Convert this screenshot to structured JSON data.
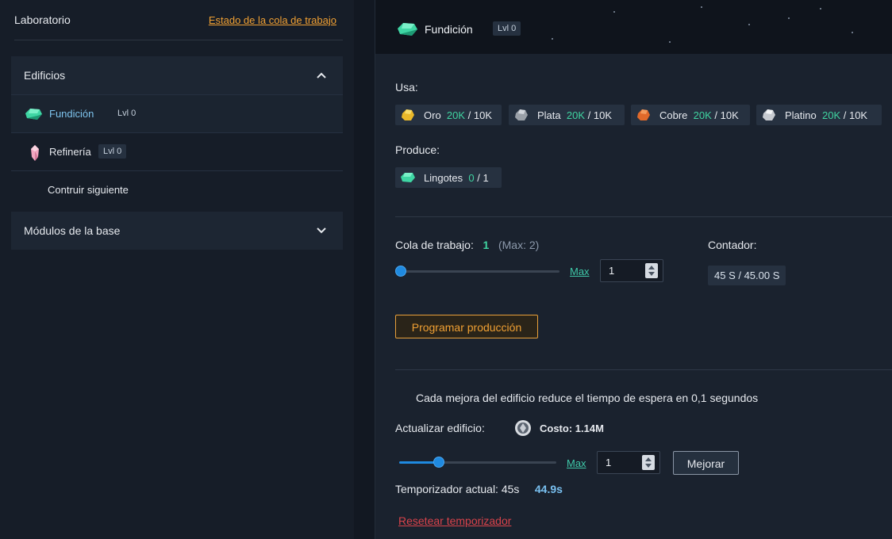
{
  "sidebar": {
    "title": "Laboratorio",
    "queue_link": "Estado de la cola de trabajo",
    "buildings": {
      "label": "Edificios",
      "items": [
        {
          "name": "Fundición",
          "level": "Lvl 0",
          "icon": "green-gem-icon"
        },
        {
          "name": "Refinería",
          "level": "Lvl 0",
          "icon": "pink-crystal-icon"
        }
      ],
      "build_next": "Contruir siguiente"
    },
    "modules": {
      "label": "Módulos de la base"
    }
  },
  "main": {
    "title": "Fundición",
    "level": "Lvl 0",
    "uses_label": "Usa:",
    "uses": [
      {
        "name": "Oro",
        "have": "20K",
        "need": "10K",
        "icon": "gold-ore-icon"
      },
      {
        "name": "Plata",
        "have": "20K",
        "need": "10K",
        "icon": "silver-ore-icon"
      },
      {
        "name": "Cobre",
        "have": "20K",
        "need": "10K",
        "icon": "copper-ore-icon"
      },
      {
        "name": "Platino",
        "have": "20K",
        "need": "10K",
        "icon": "platinum-ore-icon"
      }
    ],
    "produces_label": "Produce:",
    "produces": {
      "name": "Lingotes",
      "have": "0",
      "need": "1",
      "icon": "ingot-gem-icon"
    },
    "queue": {
      "label": "Cola de trabajo:",
      "value": "1",
      "max_note": "(Max: 2)",
      "slider_fraction": 0,
      "max_link": "Max",
      "input_value": "1"
    },
    "counter": {
      "label": "Contador:",
      "value": "45 S / 45.00 S"
    },
    "schedule_button": "Programar producción",
    "upgrade_note": "Cada mejora del edificio reduce el tiempo de espera en 0,1 segundos",
    "upgrade": {
      "label": "Actualizar edificio:",
      "cost": "Costo: 1.14M",
      "slider_fraction": 0.25,
      "max_link": "Max",
      "input_value": "1",
      "button": "Mejorar"
    },
    "timer": {
      "label": "Temporizador actual: 45s",
      "new_value": "44.9s"
    },
    "reset_link": "Resetear temporizador"
  },
  "colors": {
    "accent_orange": "#f0a033",
    "accent_green": "#3fd4a0",
    "accent_blue": "#1f8ae0",
    "danger_red": "#d9434b"
  }
}
